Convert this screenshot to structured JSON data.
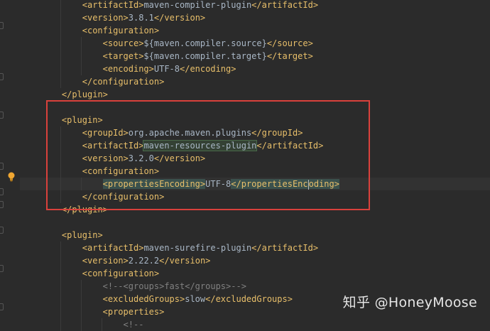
{
  "code_lines": [
    {
      "parts": [
        {
          "c": "tag",
          "t": "<artifactId>"
        },
        {
          "c": "txt",
          "t": "maven-compiler-plugin"
        },
        {
          "c": "tag",
          "t": "</artifactId>"
        }
      ]
    },
    {
      "parts": [
        {
          "c": "tag",
          "t": "<version>"
        },
        {
          "c": "txt",
          "t": "3.8.1"
        },
        {
          "c": "tag",
          "t": "</version>"
        }
      ]
    },
    {
      "parts": [
        {
          "c": "tag",
          "t": "<configuration>"
        }
      ]
    },
    {
      "parts": [
        {
          "c": "tag",
          "t": "<source>"
        },
        {
          "c": "txt",
          "t": "${maven.compiler.source}"
        },
        {
          "c": "tag",
          "t": "</source>"
        }
      ]
    },
    {
      "parts": [
        {
          "c": "tag",
          "t": "<target>"
        },
        {
          "c": "txt",
          "t": "${maven.compiler.target}"
        },
        {
          "c": "tag",
          "t": "</target>"
        }
      ]
    },
    {
      "parts": [
        {
          "c": "tag",
          "t": "<encoding>"
        },
        {
          "c": "txt",
          "t": "UTF-8"
        },
        {
          "c": "tag",
          "t": "</encoding>"
        }
      ]
    },
    {
      "parts": [
        {
          "c": "tag",
          "t": "</configuration>"
        }
      ]
    },
    {
      "parts": [
        {
          "c": "tag",
          "t": "</plugin>"
        }
      ]
    },
    {
      "parts": []
    },
    {
      "parts": [
        {
          "c": "tag",
          "t": "<plugin>"
        }
      ]
    },
    {
      "parts": [
        {
          "c": "tag",
          "t": "<groupId>"
        },
        {
          "c": "txt",
          "t": "org.apache.maven.plugins"
        },
        {
          "c": "tag",
          "t": "</groupId>"
        }
      ]
    },
    {
      "parts": [
        {
          "c": "tag",
          "t": "<artifactId>"
        },
        {
          "c": "txt hl-green",
          "t": "maven-resources-plugin"
        },
        {
          "c": "tag",
          "t": "</artifactId>"
        }
      ]
    },
    {
      "parts": [
        {
          "c": "tag",
          "t": "<version>"
        },
        {
          "c": "txt",
          "t": "3.2.0"
        },
        {
          "c": "tag",
          "t": "</version>"
        }
      ]
    },
    {
      "parts": [
        {
          "c": "tag",
          "t": "<configuration>"
        }
      ]
    },
    {
      "parts": [
        {
          "c": "tag hl-match",
          "t": "<propertiesEncoding>"
        },
        {
          "c": "txt",
          "t": "UTF-8"
        },
        {
          "c": "tag hl-match",
          "t": "</propertiesEnc"
        },
        {
          "c": "caret",
          "t": ""
        },
        {
          "c": "tag hl-match",
          "t": "oding>"
        }
      ]
    },
    {
      "parts": [
        {
          "c": "tag",
          "t": "</configuration>"
        }
      ]
    },
    {
      "parts": [
        {
          "c": "tag",
          "t": "</plugin>"
        }
      ]
    },
    {
      "parts": []
    },
    {
      "parts": [
        {
          "c": "tag",
          "t": "<plugin>"
        }
      ]
    },
    {
      "parts": [
        {
          "c": "tag",
          "t": "<artifactId>"
        },
        {
          "c": "txt",
          "t": "maven-surefire-plugin"
        },
        {
          "c": "tag",
          "t": "</artifactId>"
        }
      ]
    },
    {
      "parts": [
        {
          "c": "tag",
          "t": "<version>"
        },
        {
          "c": "txt",
          "t": "2.22.2"
        },
        {
          "c": "tag",
          "t": "</version>"
        }
      ]
    },
    {
      "parts": [
        {
          "c": "tag",
          "t": "<configuration>"
        }
      ]
    },
    {
      "parts": [
        {
          "c": "cmt",
          "t": "<!--<groups>fast</groups>-->"
        }
      ]
    },
    {
      "parts": [
        {
          "c": "tag",
          "t": "<excludedGroups>"
        },
        {
          "c": "txt",
          "t": "slow"
        },
        {
          "c": "tag",
          "t": "</excludedGroups>"
        }
      ]
    },
    {
      "parts": [
        {
          "c": "tag",
          "t": "<properties>"
        }
      ]
    },
    {
      "parts": [
        {
          "c": "cmt",
          "t": "<!--"
        }
      ]
    }
  ],
  "watermark": "知乎 @HoneyMoose"
}
